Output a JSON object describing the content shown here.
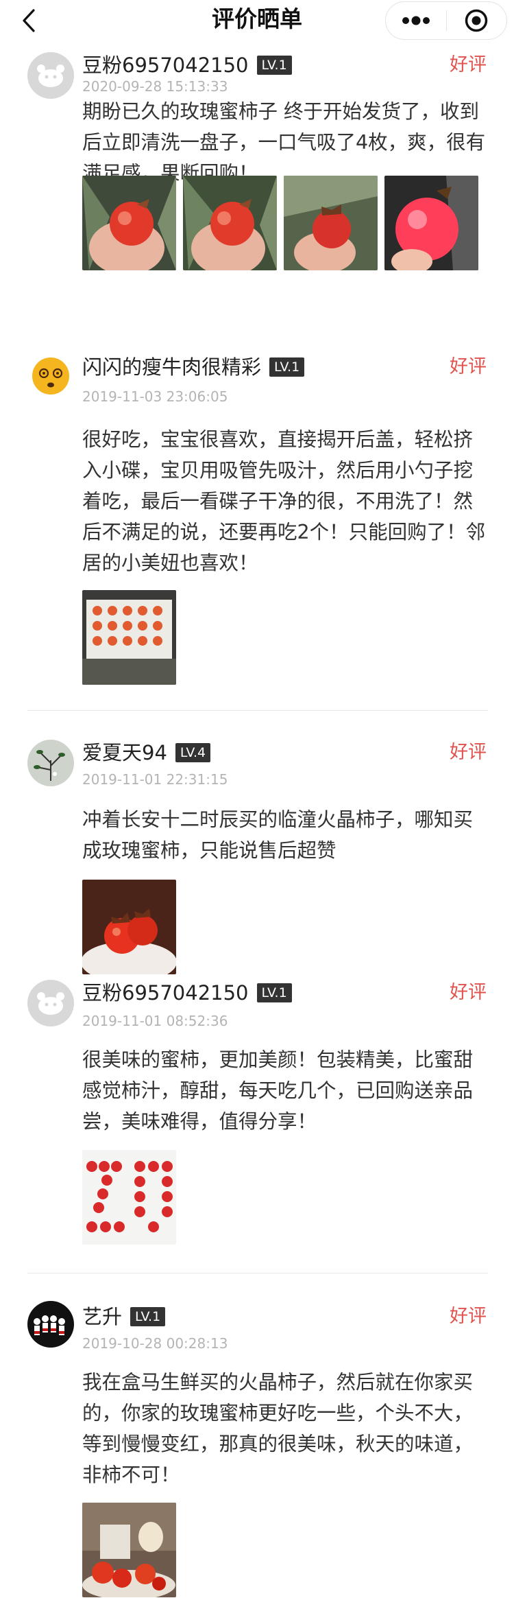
{
  "header": {
    "title": "评价晒单"
  },
  "reviews": [
    {
      "username": "豆粉6957042150",
      "level": "LV.1",
      "rating": "好评",
      "time": "2020-09-28 15:13:33",
      "text": "期盼已久的玫瑰蜜柿子 终于开始发货了，收到后立即清洗一盘子，一口气吸了4枚，爽，很有满足感，果断回购！",
      "photo_count": 4
    },
    {
      "username": "闪闪的瘦牛肉很精彩",
      "level": "LV.1",
      "rating": "好评",
      "time": "2019-11-03 23:06:05",
      "text": "很好吃，宝宝很喜欢，直接揭开后盖，轻松挤入小碟，宝贝用吸管先吸汁，然后用小勺子挖着吃，最后一看碟子干净的很，不用洗了！然后不满足的说，还要再吃2个！只能回购了！邻居的小美妞也喜欢！",
      "photo_count": 1
    },
    {
      "username": "爱夏天94",
      "level": "LV.4",
      "rating": "好评",
      "time": "2019-11-01 22:31:15",
      "text": "冲着长安十二时辰买的临潼火晶柿子，哪知买成玫瑰蜜柿，只能说售后超赞",
      "photo_count": 1
    },
    {
      "username": "豆粉6957042150",
      "level": "LV.1",
      "rating": "好评",
      "time": "2019-11-01 08:52:36",
      "text": "很美味的蜜柿，更加美颜！包装精美，比蜜甜感觉柿汁，醇甜，每天吃几个，已回购送亲品尝，美味难得，值得分享！",
      "photo_count": 1
    },
    {
      "username": "艺升",
      "level": "LV.1",
      "rating": "好评",
      "time": "2019-10-28 00:28:13",
      "text": "我在盒马生鲜买的火晶柿子，然后就在你家买的，你家的玫瑰蜜柿更好吃一些，个头不大，等到慢慢变红，那真的很美味，秋天的味道，非柿不可！",
      "photo_count": 1
    }
  ]
}
